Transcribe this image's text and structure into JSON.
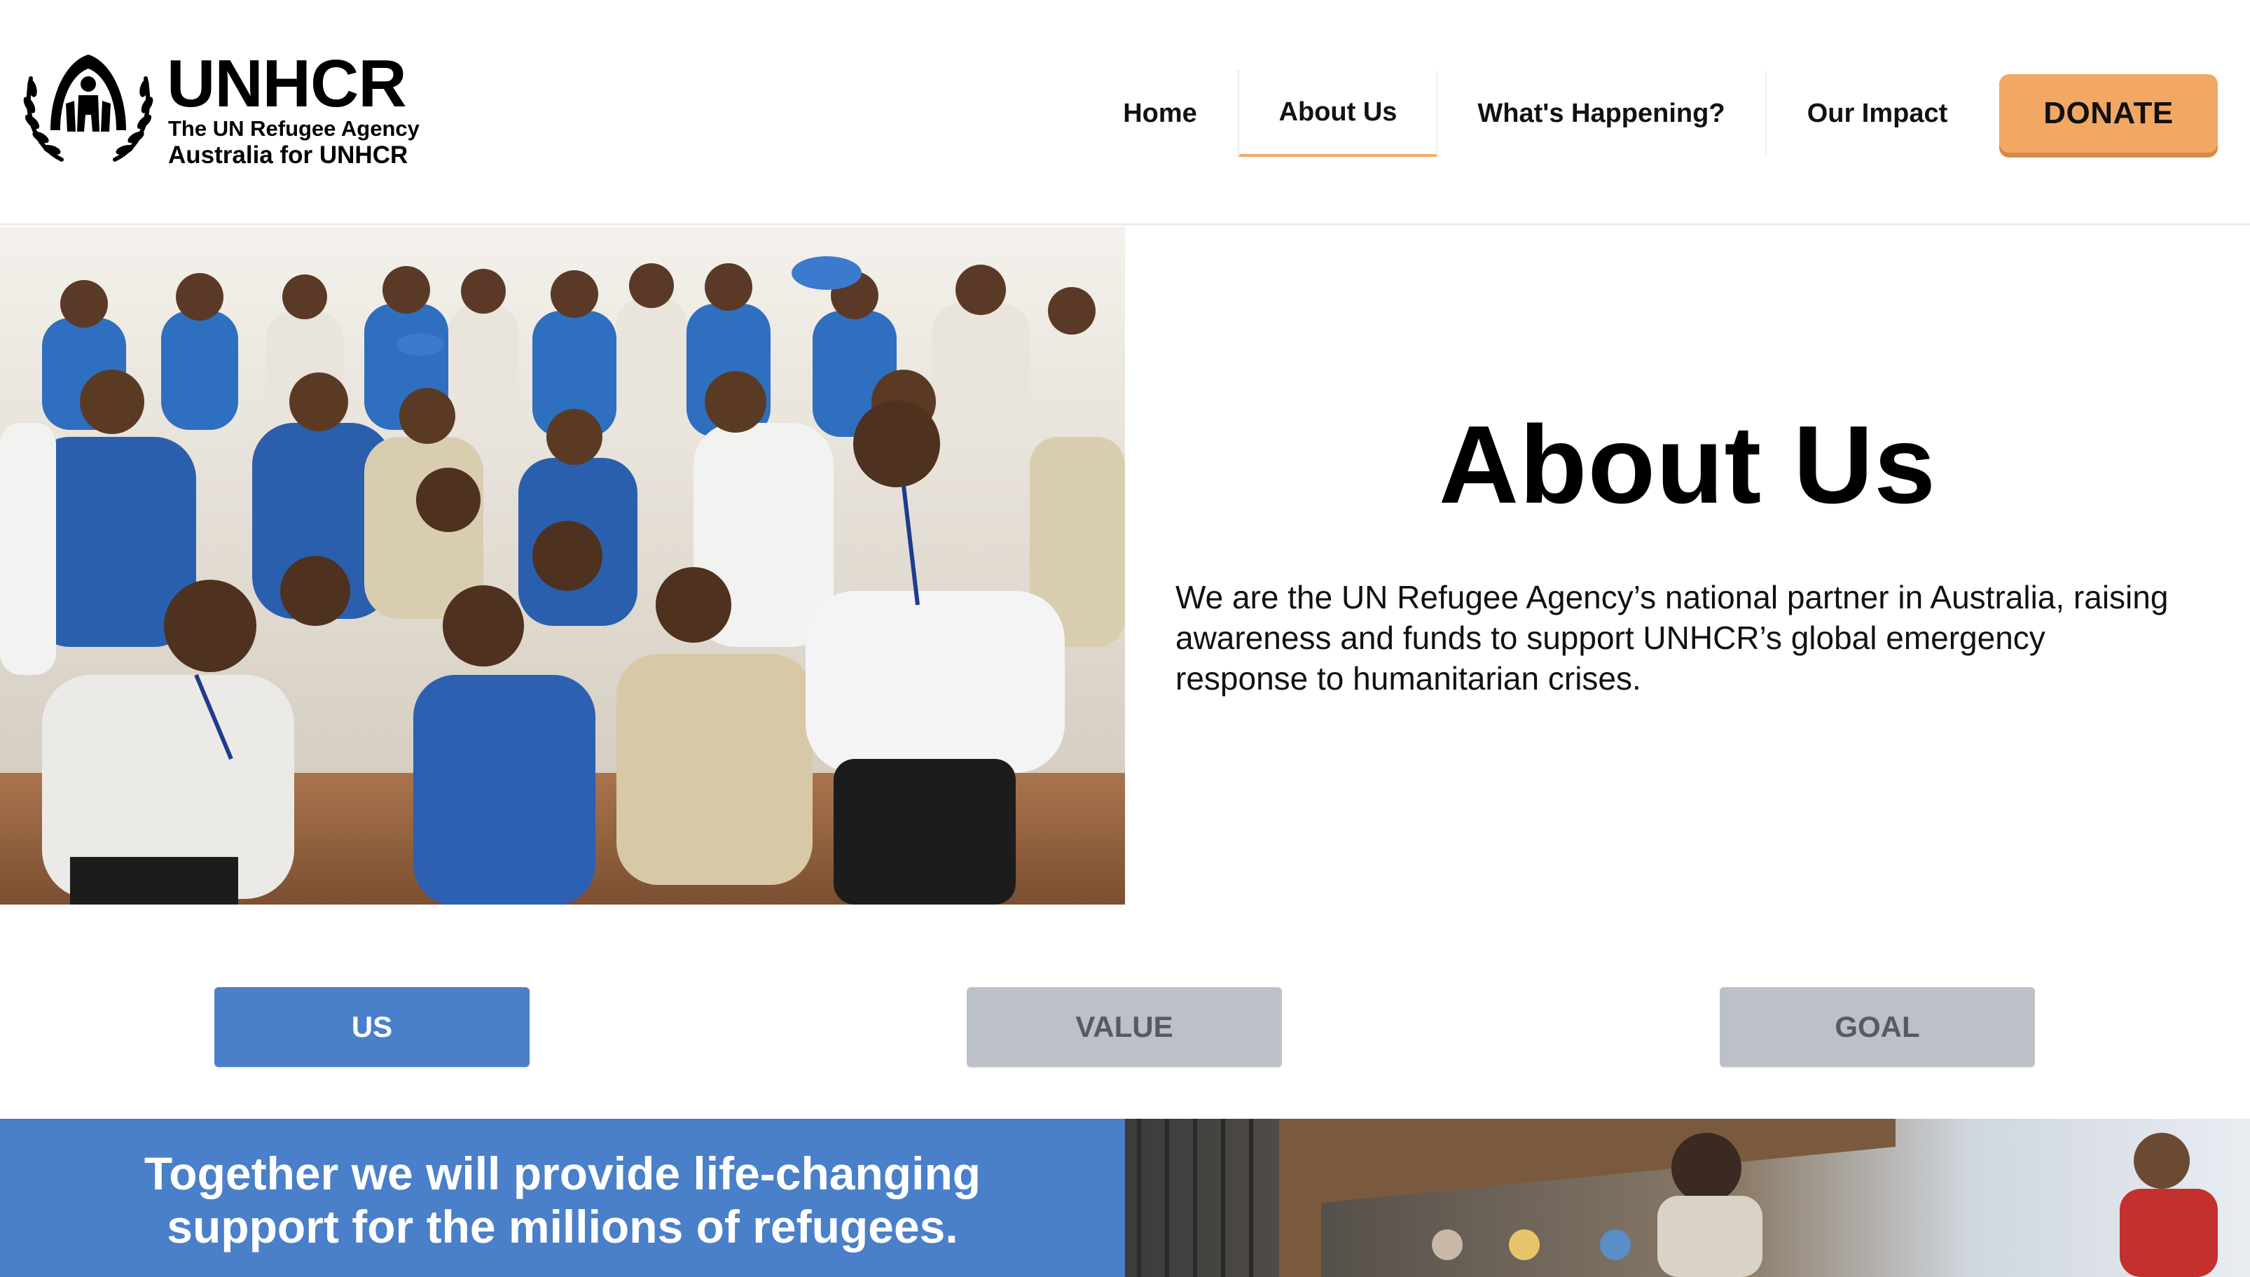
{
  "logo": {
    "title": "UNHCR",
    "subtitle": "The UN Refugee Agency",
    "org": "Australia for UNHCR"
  },
  "nav": {
    "items": [
      {
        "label": "Home"
      },
      {
        "label": "About Us",
        "active": true
      },
      {
        "label": "What's Happening?"
      },
      {
        "label": "Our Impact"
      }
    ],
    "donate_label": "DONATE"
  },
  "hero": {
    "title": "About Us",
    "description": "We are the UN Refugee Agency’s national partner in Australia, raising awareness and funds to support UNHCR’s global emergency response to humanitarian crises."
  },
  "tabs": [
    {
      "label": "US",
      "active": true
    },
    {
      "label": "VALUE",
      "active": false
    },
    {
      "label": "GOAL",
      "active": false
    }
  ],
  "banner": {
    "line1": "Together we will provide life-changing",
    "line2": "support for the millions of refugees."
  },
  "colors": {
    "accent_orange": "#f2a862",
    "brand_blue": "#4a7fc9",
    "inactive_tab": "#bcc1c7"
  },
  "icons": {
    "logo_emblem": "unhcr-laurel-emblem-icon"
  }
}
